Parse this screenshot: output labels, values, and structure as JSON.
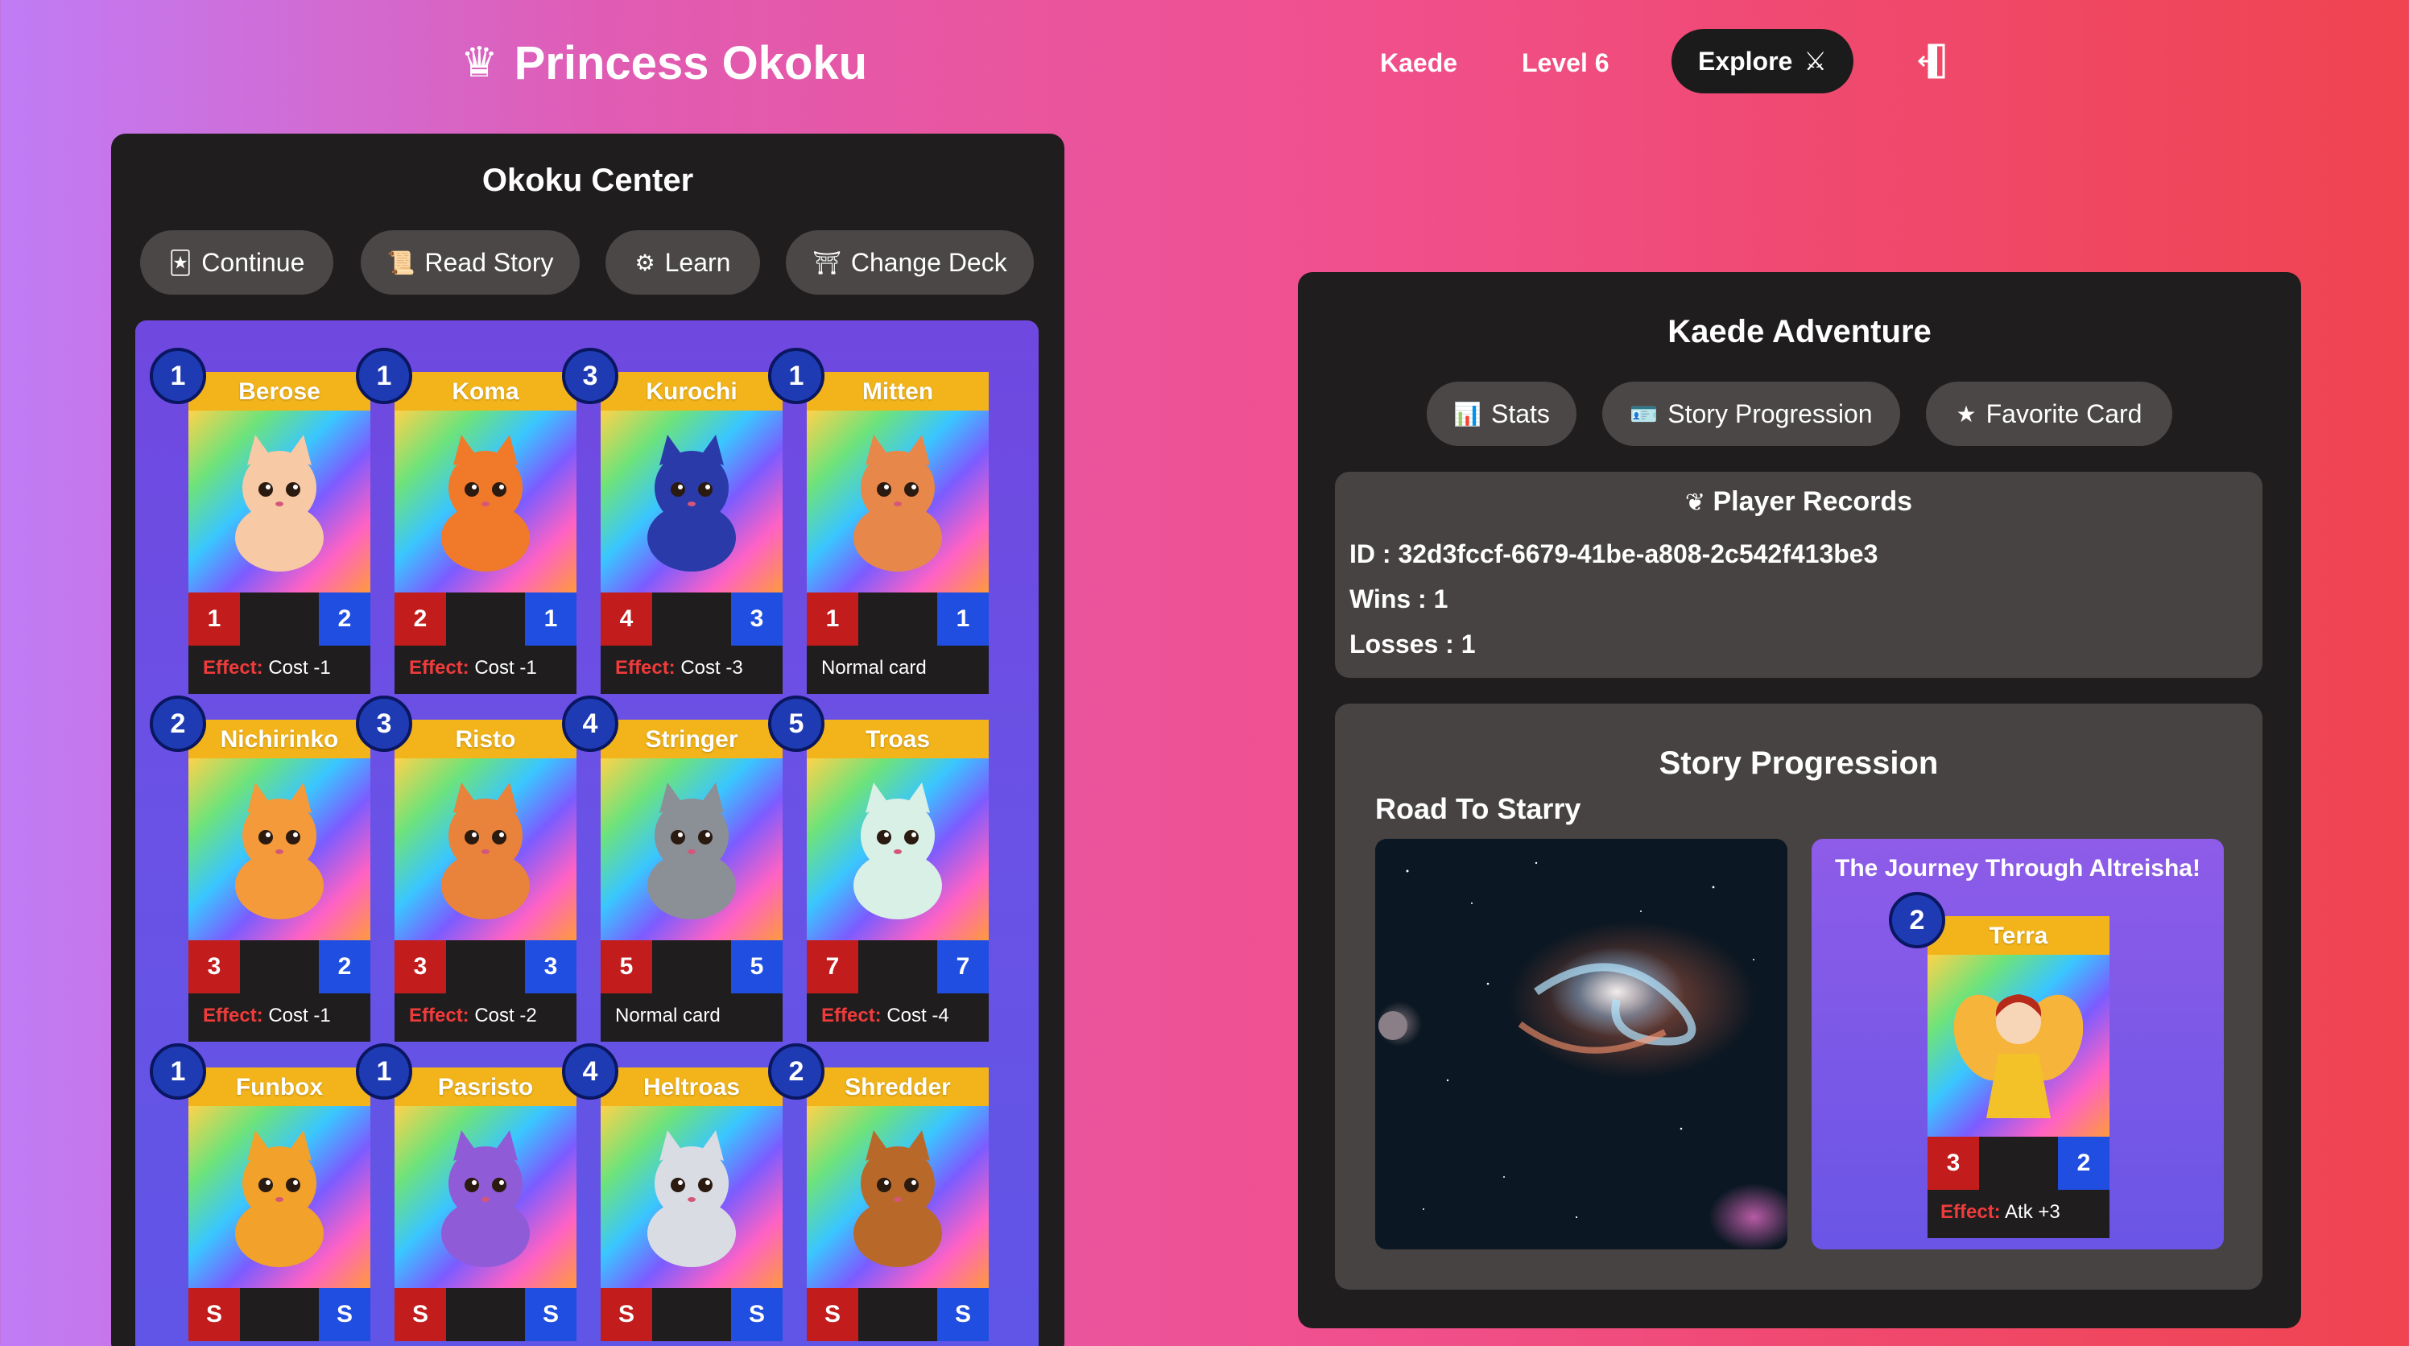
{
  "header": {
    "brand_icon": "crown-icon",
    "brand": "Princess Okoku",
    "username": "Kaede",
    "level": "Level 6",
    "explore_label": "Explore",
    "explore_icon": "crossed-swords-icon",
    "exit_icon": "door-exit-icon"
  },
  "center": {
    "title": "Okoku Center",
    "buttons": [
      {
        "label": "Continue",
        "icon": "card-icon"
      },
      {
        "label": "Read Story",
        "icon": "scroll-icon"
      },
      {
        "label": "Learn",
        "icon": "gear-icon"
      },
      {
        "label": "Change Deck",
        "icon": "shrine-icon"
      }
    ],
    "effect_label": "Effect:",
    "deck": [
      {
        "name": "Berose",
        "cost": "1",
        "atk": "1",
        "def": "2",
        "effect": "Cost -1",
        "has_effect": true
      },
      {
        "name": "Koma",
        "cost": "1",
        "atk": "2",
        "def": "1",
        "effect": "Cost -1",
        "has_effect": true
      },
      {
        "name": "Kurochi",
        "cost": "3",
        "atk": "4",
        "def": "3",
        "effect": "Cost -3",
        "has_effect": true
      },
      {
        "name": "Mitten",
        "cost": "1",
        "atk": "1",
        "def": "1",
        "effect": "Normal card",
        "has_effect": false
      },
      {
        "name": "Nichirinko",
        "cost": "2",
        "atk": "3",
        "def": "2",
        "effect": "Cost -1",
        "has_effect": true
      },
      {
        "name": "Risto",
        "cost": "3",
        "atk": "3",
        "def": "3",
        "effect": "Cost -2",
        "has_effect": true
      },
      {
        "name": "Stringer",
        "cost": "4",
        "atk": "5",
        "def": "5",
        "effect": "Normal card",
        "has_effect": false
      },
      {
        "name": "Troas",
        "cost": "5",
        "atk": "7",
        "def": "7",
        "effect": "Cost -4",
        "has_effect": true
      },
      {
        "name": "Funbox",
        "cost": "1",
        "atk": "S",
        "def": "S",
        "effect": "",
        "has_effect": false
      },
      {
        "name": "Pasristo",
        "cost": "1",
        "atk": "S",
        "def": "S",
        "effect": "",
        "has_effect": false
      },
      {
        "name": "Heltroas",
        "cost": "4",
        "atk": "S",
        "def": "S",
        "effect": "",
        "has_effect": false
      },
      {
        "name": "Shredder",
        "cost": "2",
        "atk": "S",
        "def": "S",
        "effect": "",
        "has_effect": false
      }
    ]
  },
  "adventure": {
    "title": "Kaede Adventure",
    "tabs": [
      {
        "label": "Stats",
        "icon": "bar-chart-icon"
      },
      {
        "label": "Story Progression",
        "icon": "id-card-icon"
      },
      {
        "label": "Favorite Card",
        "icon": "star-icon"
      }
    ],
    "records": {
      "title": "Player Records",
      "icon": "laurel-icon",
      "id_line": "ID : 32d3fccf-6679-41be-a808-2c542f413be3",
      "wins_line": "Wins : 1",
      "losses_line": "Losses : 1"
    },
    "story": {
      "title": "Story Progression",
      "chapter": "Road To Starry",
      "journey_title": "The Journey Through Altreisha!",
      "reward_card": {
        "name": "Terra",
        "cost": "2",
        "atk": "3",
        "def": "2",
        "effect_label": "Effect:",
        "effect": "Atk +3"
      }
    }
  },
  "colors": {
    "panel": "#1f1d1d",
    "pill": "#4a4746",
    "card_name_bar": "#f2b41a",
    "atk": "#c21c1c",
    "def": "#1f4ee0",
    "effect_label": "#ef3b3b",
    "cost_badge": "#1e3bb3"
  }
}
